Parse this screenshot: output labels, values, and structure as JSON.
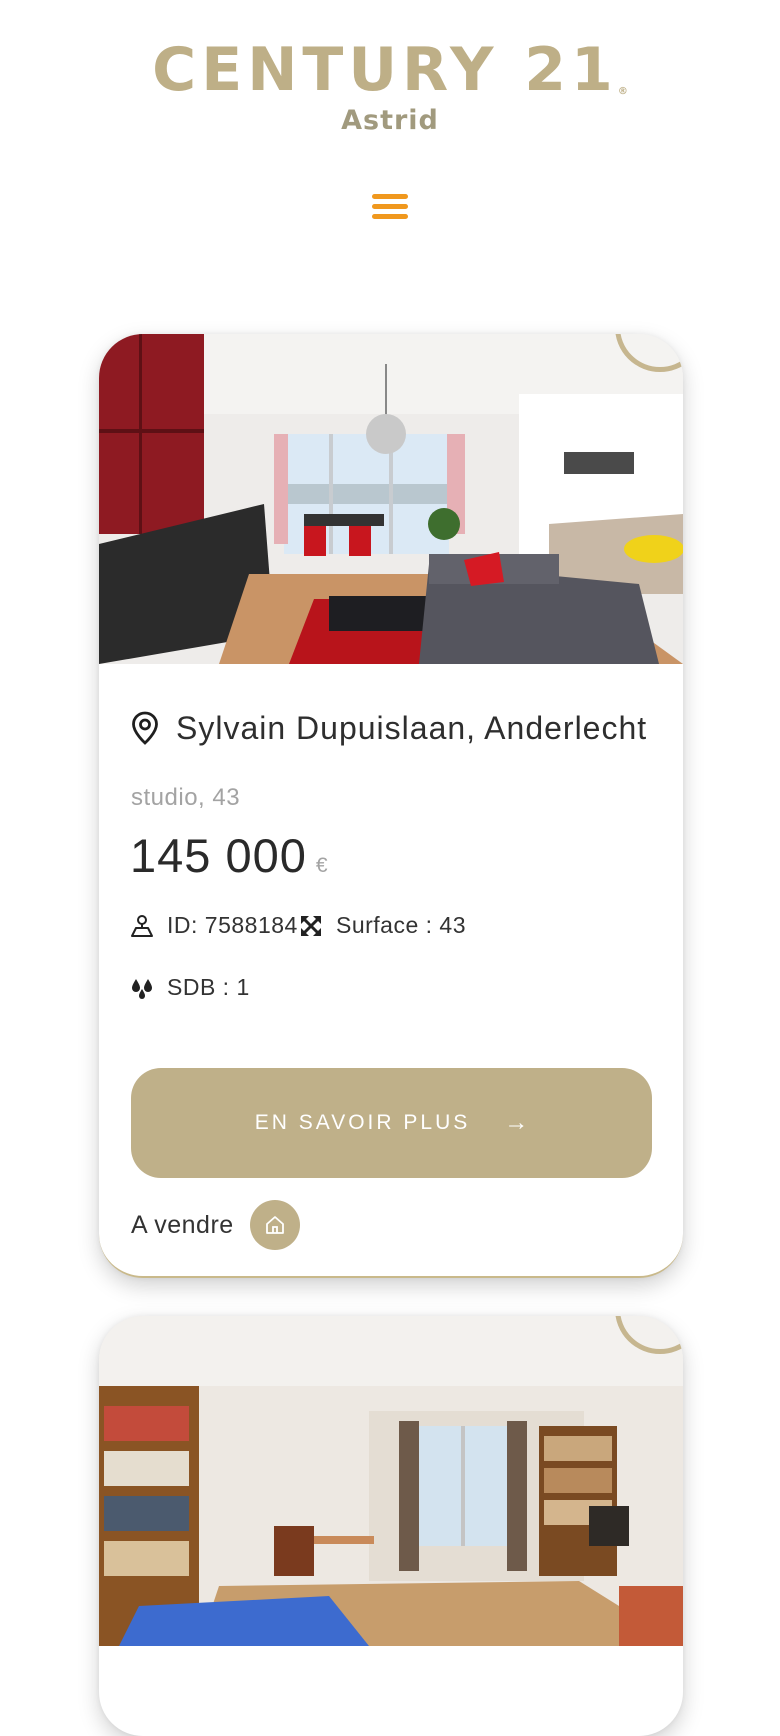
{
  "brand": {
    "name": "CENTURY 21",
    "agency": "Astrid",
    "color": "#beaf87"
  },
  "menu": {
    "icon": "hamburger-menu-icon",
    "color": "#f0981e"
  },
  "listings": [
    {
      "photo": "living-room-photo",
      "address": "Sylvain Dupuislaan, Anderlecht",
      "type_line": "studio, 43",
      "price": "145 000",
      "currency": "€",
      "id_text": "ID: 7588184",
      "surface_text": "Surface : 43",
      "sdb_text": "SDB : 1",
      "cta_label": "EN SAVOIR PLUS",
      "cta_arrow": "→",
      "status": "A vendre",
      "status_icon": "home-icon"
    },
    {
      "photo": "library-room-photo"
    }
  ]
}
